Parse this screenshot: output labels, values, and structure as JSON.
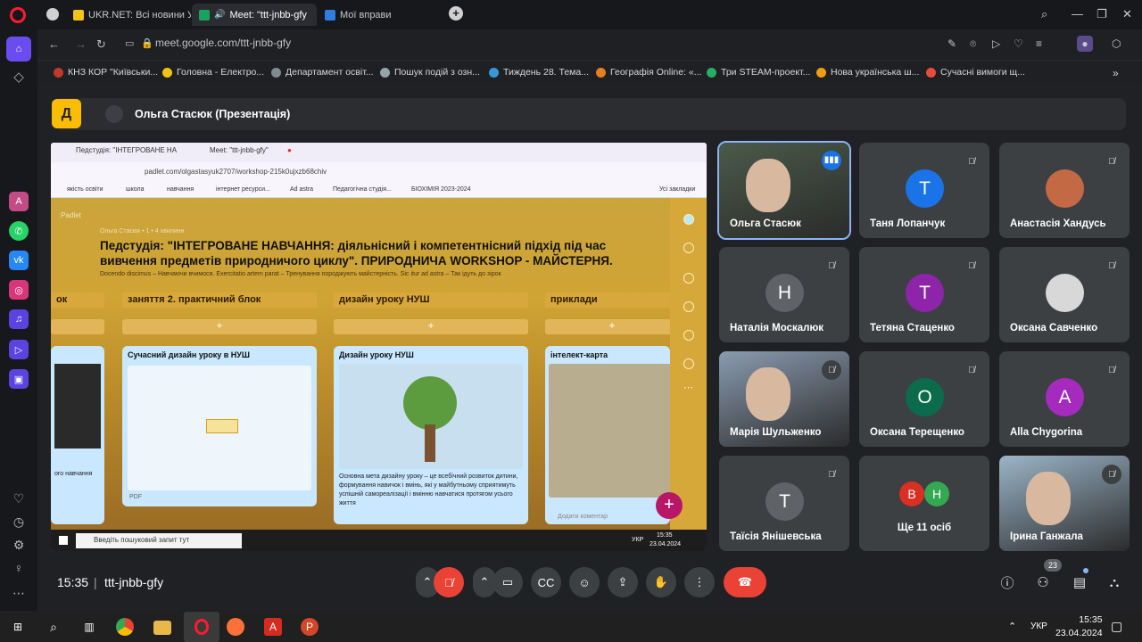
{
  "browser": {
    "tabs": [
      {
        "label": "UKR.NET: Всі новини Укр",
        "icon_color": "#f3c318"
      },
      {
        "label": "Meet: \"ttt-jnbb-gfy",
        "icon_color": "#1aa260"
      },
      {
        "label": "Мої вправи",
        "icon_color": "#2f7de1"
      }
    ],
    "url": "meet.google.com/ttt-jnbb-gfy",
    "bookmarks": [
      {
        "label": "КНЗ КОР \"Київськи...",
        "icon_color": "#c0392b"
      },
      {
        "label": "Головна - Електро...",
        "icon_color": "#f1c40f"
      },
      {
        "label": "Департамент освіт...",
        "icon_color": "#7f8c8d"
      },
      {
        "label": "Пошук подій з озн...",
        "icon_color": "#95a5a6"
      },
      {
        "label": "Тиждень 28. Тема...",
        "icon_color": "#3498db"
      },
      {
        "label": "Географія Online: «...",
        "icon_color": "#e67e22"
      },
      {
        "label": "Три STEAM-проект...",
        "icon_color": "#27ae60"
      },
      {
        "label": "Нова українська ш...",
        "icon_color": "#f39c12"
      },
      {
        "label": "Сучасні вимоги щ...",
        "icon_color": "#e74c3c"
      }
    ]
  },
  "meet": {
    "presenter_label": "Ольга Стасюк (Презентація)",
    "logo_letter": "Д",
    "clock": "15:35",
    "code": "ttt-jnbb-gfy",
    "participants_count": "23",
    "tiles": [
      {
        "name": "Ольга Стасюк",
        "type": "video",
        "video_color": "#4a5a49",
        "speaking": true
      },
      {
        "name": "Таня Лопанчук",
        "type": "avatar",
        "letter": "Т",
        "color": "#1a73e8"
      },
      {
        "name": "Анастасія Хандусь",
        "type": "photo",
        "color": "#c36a45"
      },
      {
        "name": "Наталія Москалюк",
        "type": "avatar",
        "letter": "Н",
        "color": "#5f6368"
      },
      {
        "name": "Тетяна Стаценко",
        "type": "avatar",
        "letter": "Т",
        "color": "#8e24aa"
      },
      {
        "name": "Оксана Савченко",
        "type": "photo",
        "color": "#d8d8d8"
      },
      {
        "name": "Марія Шульженко",
        "type": "video",
        "video_color": "#8a9bb0"
      },
      {
        "name": "Оксана Терещенко",
        "type": "avatar",
        "letter": "О",
        "color": "#0b6b4a"
      },
      {
        "name": "Alla Chygorina",
        "type": "avatar",
        "letter": "A",
        "color": "#a42bbd"
      },
      {
        "name": "Таїсія Янішевська",
        "type": "avatar",
        "letter": "Т",
        "color": "#5f6368"
      },
      {
        "name": "Ще 11 осіб",
        "type": "more",
        "letters": [
          "В",
          "Н"
        ],
        "colors": [
          "#d93025",
          "#34a853"
        ]
      },
      {
        "name": "Ірина Ганжала",
        "type": "video",
        "video_color": "#9bb5c8"
      }
    ]
  },
  "shared": {
    "tabs": [
      "Педстудія: \"ІНТЕГРОВАНЕ НА",
      "Meet: \"ttt-jnbb-gfy\""
    ],
    "url": "padlet.com/olgastasyuk2707/workshop-215k0ujxzb68chiv",
    "bookmarks": [
      "якість освіти",
      "школа",
      "навчання",
      "інтернет ресурси...",
      "Ad astra",
      "Педагогічна студія...",
      "БІОХІМІЯ 2023-2024",
      "Усі закладки"
    ],
    "padlet_brand": ":Padlet",
    "meta": "Ольга Стасюк • 1 • 4 хвилини",
    "title": "Педстудія: \"ІНТЕГРОВАНЕ НАВЧАННЯ: діяльнісний і компетентнісний підхід під час вивчення предметів природничого циклу\". ПРИРОДНИЧА WORKSHOP - МАЙСТЕРНЯ.",
    "subtitle": "Docendo discimus – Навчаючи вчимося. Exercitatio artem parat – Тренування породжують майстерність. Sic itur ad astra – Так ідуть до зірок",
    "columns": [
      "ок",
      "заняття 2. практичний блок",
      "дизайн уроку НУШ",
      "приклади"
    ],
    "cards": [
      {
        "title": "Сучасний дизайн уроку в НУШ",
        "badge": "PDF"
      },
      {
        "title": "Дизайн уроку НУШ",
        "text": "Основна мета дизайну уроку – це всебічний розвиток дитини, формування навичок і вмінь, які у майбутньому сприятимуть успішній самореалізації і вмінню навчатися протягом усього життя"
      },
      {
        "title": "інтелект-карта",
        "comment": "Додати коментар"
      }
    ],
    "left_card_text": "ого навчання",
    "search_placeholder": "Введіть пошуковий запит тут",
    "lang": "УКР",
    "time": "15:35",
    "date": "23.04.2024"
  },
  "taskbar": {
    "lang": "УКР",
    "time": "15:35",
    "date": "23.04.2024"
  }
}
